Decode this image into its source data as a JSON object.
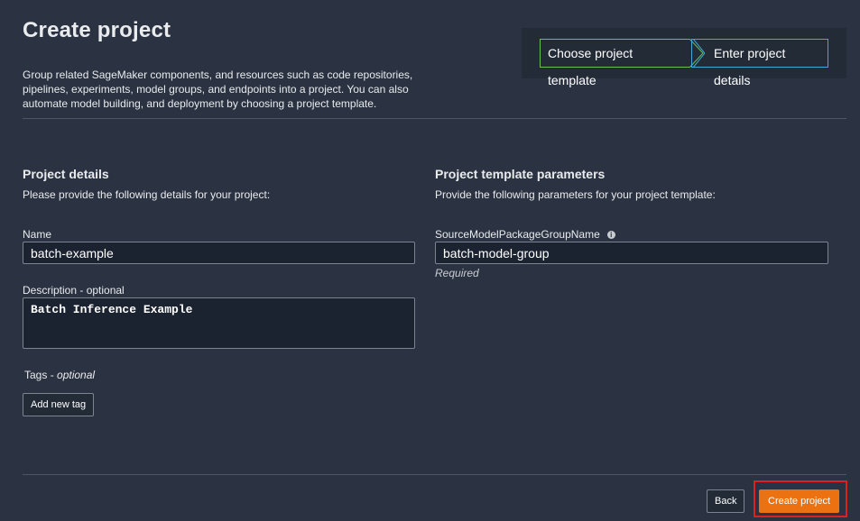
{
  "page": {
    "title": "Create project",
    "description": "Group related SageMaker components, and resources such as code repositories, pipelines, experiments, model groups, and endpoints into a project. You can also automate model building, and deployment by choosing a project template."
  },
  "wizard": {
    "steps": [
      {
        "label": "Choose project template",
        "state": "completed"
      },
      {
        "label": "Enter project details",
        "state": "current"
      }
    ]
  },
  "project_details": {
    "heading": "Project details",
    "subtitle": "Please provide the following details for your project:",
    "name_label": "Name",
    "name_value": "batch-example",
    "description_label": "Description - optional",
    "description_value": "Batch Inference Example",
    "tags_label": "Tags",
    "tags_optional": "optional",
    "tags_separator": " - ",
    "add_tag_label": "Add new tag"
  },
  "template_params": {
    "heading": "Project template parameters",
    "subtitle": "Provide the following parameters for your project template:",
    "param_label": "SourceModelPackageGroupName",
    "param_info_icon": "info-icon",
    "param_value": "batch-model-group",
    "param_note": "Required"
  },
  "footer": {
    "back_label": "Back",
    "create_label": "Create project"
  },
  "colors": {
    "background": "#2b3342",
    "primary_button": "#ec7211",
    "completed_step_border": "#6bbf59",
    "current_step_border": "#3fa8d8",
    "highlight": "#e02020"
  }
}
